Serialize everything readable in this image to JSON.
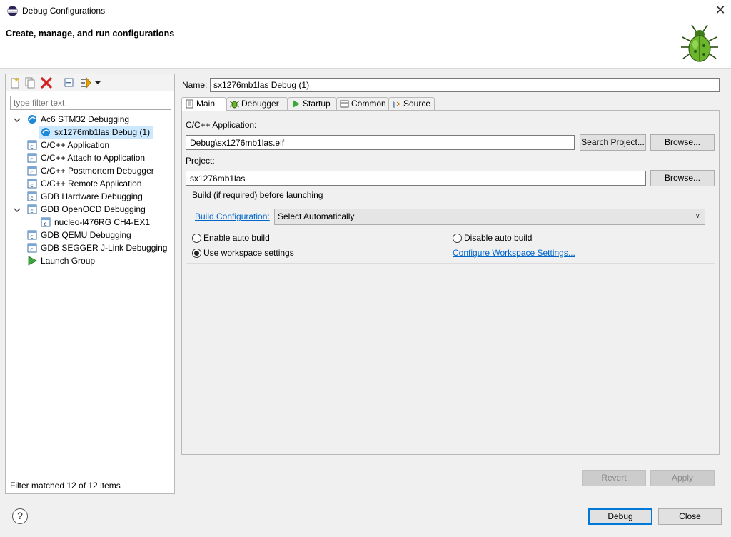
{
  "window": {
    "title": "Debug Configurations",
    "close_glyph": "✕",
    "heading": "Create, manage, and run configurations",
    "bug_icon": "bug-icon"
  },
  "left": {
    "toolbar_icons": [
      "new-configuration-icon",
      "duplicate-icon",
      "delete-icon",
      "collapse-all-icon",
      "filter-icon",
      "dropdown-arrow-icon"
    ],
    "filter_placeholder": "type filter text",
    "tree": [
      {
        "label": "Ac6 STM32 Debugging",
        "level": 0,
        "expanded": true,
        "icon": "ac6-icon"
      },
      {
        "label": "sx1276mb1las Debug (1)",
        "level": 1,
        "selected": true,
        "icon": "ac6-icon"
      },
      {
        "label": "C/C++ Application",
        "level": 0,
        "icon": "c-app-icon"
      },
      {
        "label": "C/C++ Attach to Application",
        "level": 0,
        "icon": "c-app-icon"
      },
      {
        "label": "C/C++ Postmortem Debugger",
        "level": 0,
        "icon": "c-app-icon"
      },
      {
        "label": "C/C++ Remote Application",
        "level": 0,
        "icon": "c-app-icon"
      },
      {
        "label": "GDB Hardware Debugging",
        "level": 0,
        "icon": "c-app-icon"
      },
      {
        "label": "GDB OpenOCD Debugging",
        "level": 0,
        "expanded": true,
        "icon": "c-app-icon"
      },
      {
        "label": "nucleo-l476RG CH4-EX1",
        "level": 1,
        "icon": "c-app-icon"
      },
      {
        "label": "GDB QEMU Debugging",
        "level": 0,
        "icon": "c-app-icon"
      },
      {
        "label": "GDB SEGGER J-Link Debugging",
        "level": 0,
        "icon": "c-app-icon"
      },
      {
        "label": "Launch Group",
        "level": 0,
        "icon": "launch-group-icon"
      }
    ],
    "filter_status": "Filter matched 12 of 12 items"
  },
  "right": {
    "name_label": "Name:",
    "name_value": "sx1276mb1las Debug (1)",
    "tabs": [
      {
        "label": "Main",
        "icon": "main-tab-icon",
        "active": true
      },
      {
        "label": "Debugger",
        "icon": "debugger-tab-icon"
      },
      {
        "label": "Startup",
        "icon": "startup-tab-icon"
      },
      {
        "label": "Common",
        "icon": "common-tab-icon"
      },
      {
        "label": "Source",
        "icon": "source-tab-icon"
      }
    ],
    "main": {
      "app_label": "C/C++ Application:",
      "app_value": "Debug\\sx1276mb1las.elf",
      "search_project": "Search Project...",
      "browse1": "Browse...",
      "project_label": "Project:",
      "project_value": "sx1276mb1las",
      "browse2": "Browse...",
      "build_group": "Build (if required) before launching",
      "build_config_link": "Build Configuration:",
      "build_config_value": "Select Automatically",
      "enable_auto_build": "Enable auto build",
      "disable_auto_build": "Disable auto build",
      "use_workspace": "Use workspace settings",
      "configure_workspace_link": "Configure Workspace Settings...",
      "selected_radio": "use_workspace"
    },
    "revert": "Revert",
    "apply": "Apply"
  },
  "footer": {
    "help_glyph": "?",
    "debug": "Debug",
    "close": "Close"
  }
}
